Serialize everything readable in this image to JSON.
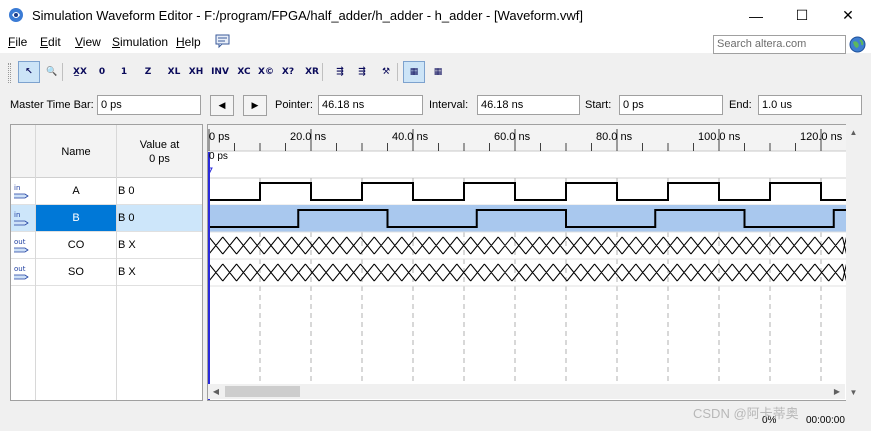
{
  "window": {
    "title": "Simulation Waveform Editor - F:/program/FPGA/half_adder/h_adder - h_adder - [Waveform.vwf]",
    "min": "—",
    "max": "☐",
    "close": "✕"
  },
  "menu": {
    "items": [
      {
        "key": "F",
        "rest": "ile"
      },
      {
        "key": "E",
        "rest": "dit"
      },
      {
        "key": "V",
        "rest": "iew"
      },
      {
        "key": "S",
        "rest": "imulation"
      },
      {
        "key": "H",
        "rest": "elp"
      }
    ],
    "search_placeholder": "Search altera.com"
  },
  "toolbar": {
    "buttons": [
      {
        "name": "selection-tool-icon",
        "glyph": "↖"
      },
      {
        "name": "zoom-tool-icon",
        "glyph": "🔍"
      },
      {
        "name": "forcing-unknown-icon",
        "glyph": "X̲X"
      },
      {
        "name": "forcing-low-icon",
        "glyph": "0"
      },
      {
        "name": "forcing-high-icon",
        "glyph": "1"
      },
      {
        "name": "high-impedance-icon",
        "glyph": "Z"
      },
      {
        "name": "weak-low-icon",
        "glyph": "XL"
      },
      {
        "name": "weak-high-icon",
        "glyph": "XH"
      },
      {
        "name": "invert-icon",
        "glyph": "INV"
      },
      {
        "name": "count-value-icon",
        "glyph": "XC"
      },
      {
        "name": "clock-value-icon",
        "glyph": "X©"
      },
      {
        "name": "arbitrary-value-icon",
        "glyph": "X?"
      },
      {
        "name": "random-value-icon",
        "glyph": "XR"
      },
      {
        "name": "run-functional-simulation-icon",
        "glyph": "⇶"
      },
      {
        "name": "run-timing-simulation-icon",
        "glyph": "⇶"
      },
      {
        "name": "generate-netlist-icon",
        "glyph": "⚒"
      },
      {
        "name": "snap-to-grid-icon",
        "glyph": "▦"
      },
      {
        "name": "grid-icon",
        "glyph": "▦"
      }
    ]
  },
  "timebar": {
    "master_label": "Master Time Bar:",
    "master_value": "0 ps",
    "prev": "◀",
    "next": "▶",
    "pointer_label": "Pointer:",
    "pointer_value": "46.18 ns",
    "interval_label": "Interval:",
    "interval_value": "46.18 ns",
    "start_label": "Start:",
    "start_value": "0 ps",
    "end_label": "End:",
    "end_value": "1.0 us"
  },
  "table": {
    "name_header": "Name",
    "value_header_line1": "Value at",
    "value_header_line2": "0 ps",
    "signals": [
      {
        "dir": "in",
        "name": "A",
        "value": "B 0",
        "selected": false
      },
      {
        "dir": "in",
        "name": "B",
        "value": "B 0",
        "selected": true
      },
      {
        "dir": "out",
        "name": "CO",
        "value": "B X",
        "selected": false
      },
      {
        "dir": "out",
        "name": "SO",
        "value": "B X",
        "selected": false
      }
    ]
  },
  "waveform": {
    "ticks": [
      "0 ps",
      "20.0 ns",
      "40.0 ns",
      "60.0 ns",
      "80.0 ns",
      "100.0 ns",
      "120.0 ns"
    ],
    "cursor_label": "0 ps",
    "signal_A_period_ns": 20,
    "signal_B_period_ns": 35,
    "view_range_ns": [
      0,
      125
    ],
    "selected_row_color": "#a9c8ee",
    "cursor_color": "#2a2adc"
  },
  "status": {
    "progress": "0%",
    "time": "00:00:00"
  },
  "watermark": "CSDN @阿卡蒂奥"
}
